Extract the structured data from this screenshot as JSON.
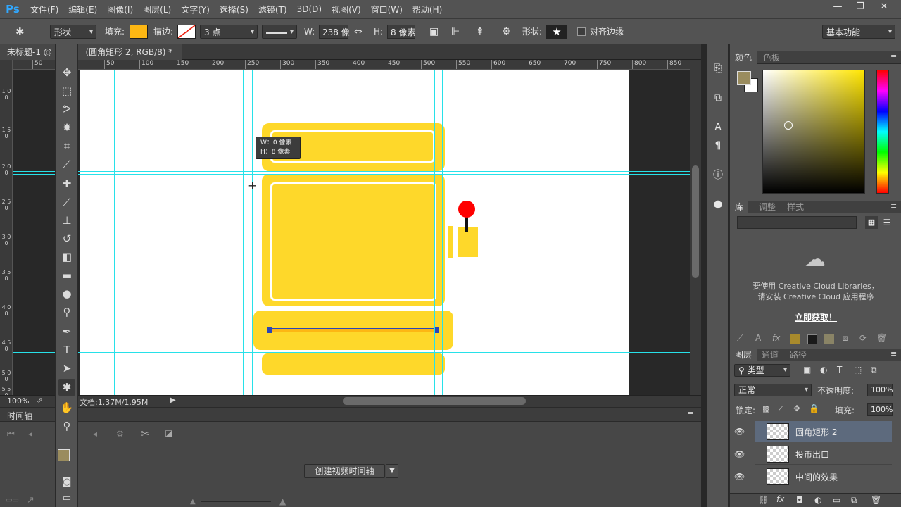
{
  "menubar": {
    "logo": "Ps",
    "items": [
      "文件(F)",
      "编辑(E)",
      "图像(I)",
      "图层(L)",
      "文字(Y)",
      "选择(S)",
      "滤镜(T)",
      "3D(D)",
      "视图(V)",
      "窗口(W)",
      "帮助(H)"
    ],
    "window_buttons": [
      "—",
      "❐",
      "✕"
    ]
  },
  "options": {
    "mode_value": "形状",
    "fill_label": "填充:",
    "fill_color": "#fdb713",
    "stroke_label": "描边:",
    "stroke_width": "3 点",
    "w_label": "W:",
    "w_value": "238 像",
    "link_icon": "⇔",
    "h_label": "H:",
    "h_value": "8 像素",
    "shape_label": "形状:",
    "align_edges_label": "对齐边缘",
    "workspace": "基本功能"
  },
  "document": {
    "tab_title": "未标题-1 @",
    "tab_title_rest": "(圆角矩形 2, RGB/8) *",
    "close": "×",
    "ruler_h": [
      "50",
      "50",
      "100",
      "150",
      "200",
      "250",
      "300",
      "350",
      "400",
      "450",
      "500",
      "550",
      "600",
      "650",
      "700",
      "750",
      "800",
      "850"
    ],
    "ruler_v": [
      "1 0 0",
      "1 5 0",
      "2 0 0",
      "2 5 0",
      "3 0 0",
      "3 5 0",
      "4 0 0",
      "4 5 0",
      "5 0 0",
      "5 5 0"
    ],
    "tooltip_w": "W：0 像素",
    "tooltip_h": "H：8 像素",
    "zoom": "100%",
    "doc_size": "文档:1.37M/1.95M"
  },
  "timeline": {
    "title": "时间轴",
    "create_button": "创建视频时间轴"
  },
  "panels": {
    "color_tab": "颜色",
    "swatches_tab": "色板",
    "library_tab": "库",
    "adjust_tab": "调整",
    "style_tab": "样式",
    "cc_line1": "要使用 Creative Cloud Libraries，",
    "cc_line2": "请安装 Creative Cloud 应用程序",
    "cc_link": "立即获取！",
    "fg_color": "#9a8c5e",
    "bg_color": "#ffffff",
    "swatch_colors": [
      "#a88a2c",
      "#1a1a1a",
      "#8a8466"
    ]
  },
  "layers": {
    "tab_layers": "图层",
    "tab_channels": "通道",
    "tab_paths": "路径",
    "filter": "类型",
    "blend_mode": "正常",
    "opacity_label": "不透明度:",
    "opacity_value": "100%",
    "lock_label": "锁定:",
    "fill_label": "填充:",
    "fill_value": "100%",
    "items": [
      {
        "name": "圆角矩形 2"
      },
      {
        "name": "投币出口"
      },
      {
        "name": "中间的效果"
      }
    ]
  }
}
